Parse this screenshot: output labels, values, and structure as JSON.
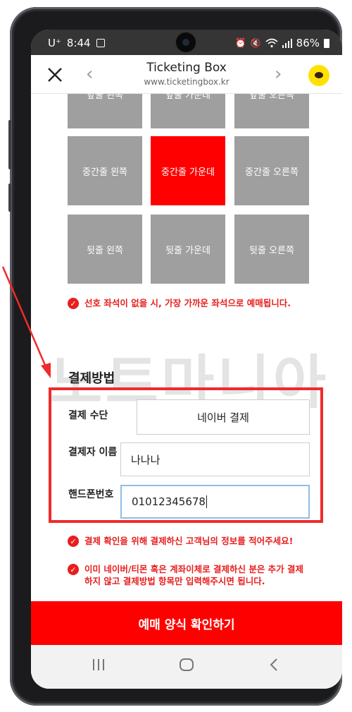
{
  "status_bar": {
    "carrier": "U⁺",
    "time": "8:44",
    "battery": "86%",
    "icons": [
      "gallery-icon",
      "alarm-icon",
      "mute-icon",
      "wifi-icon",
      "signal-icon",
      "battery-icon"
    ]
  },
  "header": {
    "title": "Ticketing Box",
    "url": "www.ticketingbox.kr",
    "icons": [
      "close-icon",
      "back-chevron-icon",
      "forward-chevron-icon",
      "kakao-chat-icon"
    ]
  },
  "seats": {
    "row_front": [
      "앞줄 왼쪽",
      "앞줄 가운데",
      "앞줄 오른쪽"
    ],
    "row_middle": [
      "중간줄 왼쪽",
      "중간줄 가운데",
      "중간줄 오른쪽"
    ],
    "row_back": [
      "뒷줄 왼쪽",
      "뒷줄 가운데",
      "뒷줄 오른쪽"
    ],
    "selected": "중간줄 가운데"
  },
  "seat_note": "선호 좌석이 없을 시, 가장 가까운 좌석으로 예매됩니다.",
  "watermark": "노트마니아",
  "payment": {
    "section_title": "결제방법",
    "method_label": "결제 수단",
    "method_value": "네이버 결제",
    "payer_label": "결제자 이름",
    "payer_value": "나나나",
    "phone_label": "핸드폰번호",
    "phone_value": "01012345678"
  },
  "notes": [
    "결제 확인을 위해 결제하신 고객님의 정보를 적어주세요!",
    "이미 네이버/티몬 혹은 계좌이체로 결제하신 분은 추가 결제하지 않고 결제방법 항목만 입력해주시면 됩니다."
  ],
  "submit_label": "예매 양식 확인하기",
  "colors": {
    "accent_red": "#ff0000",
    "seat_gray": "#9f9f9f",
    "annotation_red": "#ef2b2b",
    "status_bar": "#353535",
    "kakao_yellow": "#ffe100"
  }
}
